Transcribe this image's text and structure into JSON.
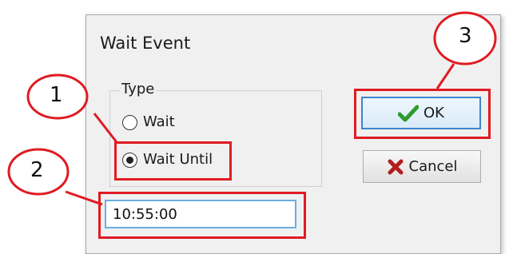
{
  "dialog": {
    "title": "Wait Event",
    "type_group": {
      "legend": "Type",
      "options": [
        {
          "label": "Wait",
          "checked": false
        },
        {
          "label": "Wait Until",
          "checked": true
        }
      ]
    },
    "buttons": {
      "ok_label": "OK",
      "cancel_label": "Cancel"
    },
    "time_input": {
      "value": "10:55:00"
    }
  },
  "callouts": [
    "1",
    "2",
    "3"
  ],
  "colors": {
    "highlight": "#e01b22",
    "ok_icon": "#2e9b2e",
    "cancel_icon": "#b41d1d",
    "focus_border": "#3b86cc"
  },
  "icons": {
    "ok": "checkmark-icon",
    "cancel": "x-mark-icon"
  }
}
